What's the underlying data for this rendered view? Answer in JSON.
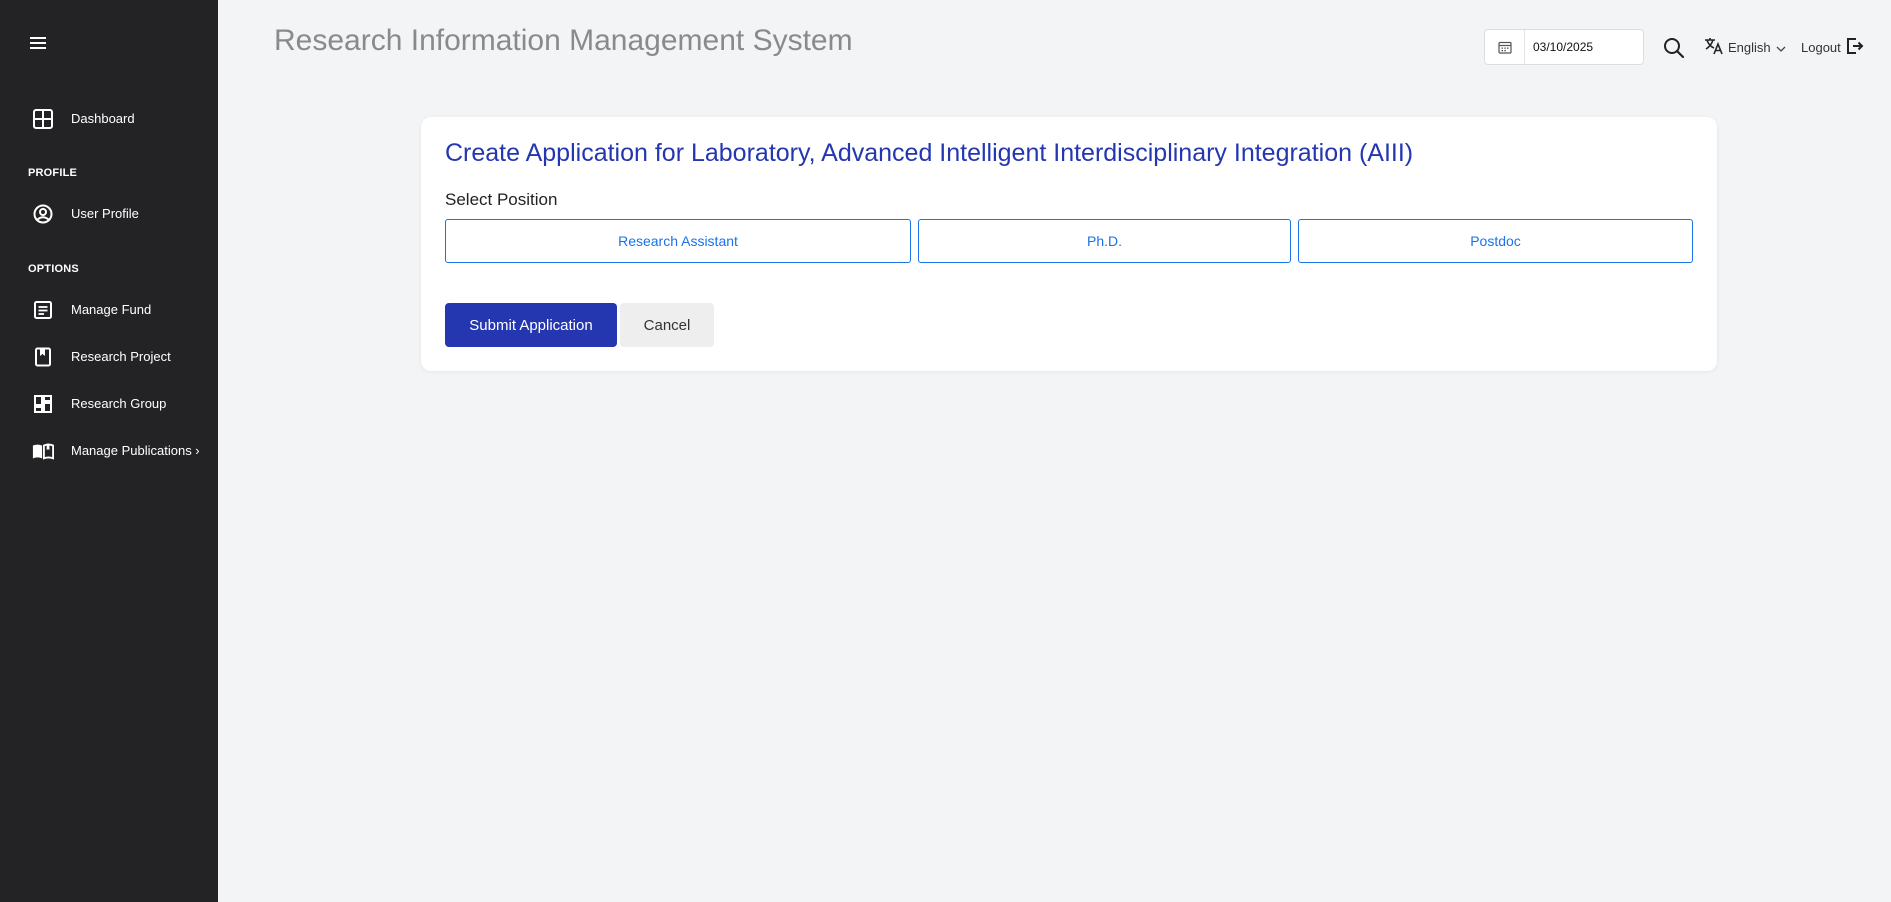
{
  "app": {
    "title": "Research Information Management System"
  },
  "sidebar": {
    "menu_icon": "hamburger-menu-icon",
    "items": [
      {
        "label": "Dashboard",
        "icon": "dashboard-grid-icon"
      },
      {
        "label": "User Profile",
        "icon": "user-circle-icon"
      },
      {
        "label": "Manage Fund",
        "icon": "document-list-icon"
      },
      {
        "label": "Research Project",
        "icon": "bookmark-book-icon"
      },
      {
        "label": "Research Group",
        "icon": "layout-grid-icon"
      },
      {
        "label": "Manage Publications ›",
        "icon": "open-book-icon"
      }
    ],
    "sections": {
      "profile": "PROFILE",
      "options": "OPTIONS"
    }
  },
  "header": {
    "date": "03/10/2025",
    "language": "English",
    "logout": "Logout"
  },
  "form": {
    "title": "Create Application for Laboratory, Advanced Intelligent Interdisciplinary Integration (AIII)",
    "select_label": "Select Position",
    "positions": [
      "Research Assistant",
      "Ph.D.",
      "Postdoc"
    ],
    "submit_label": "Submit Application",
    "cancel_label": "Cancel"
  },
  "colors": {
    "sidebar_bg": "#232325",
    "accent": "#2436b0",
    "link_blue": "#1a73e8",
    "page_bg": "#f3f4f6"
  }
}
